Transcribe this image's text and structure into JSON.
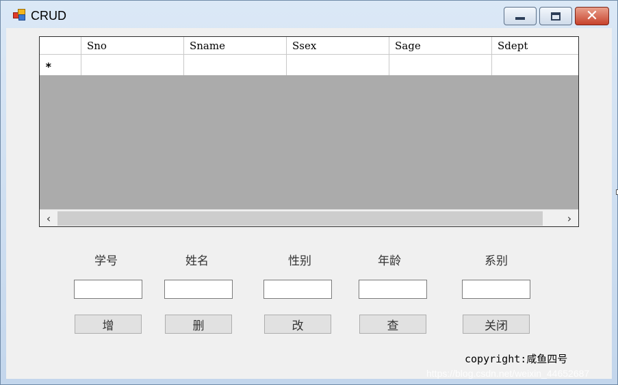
{
  "window": {
    "title": "CRUD",
    "controls": {
      "minimize": "minimize",
      "maximize": "maximize",
      "close": "✕"
    }
  },
  "grid": {
    "columns": [
      "Sno",
      "Sname",
      "Ssex",
      "Sage",
      "Sdept"
    ],
    "new_row_marker": "*",
    "rows": [
      [
        "",
        "",
        "",
        "",
        ""
      ]
    ],
    "scroll_left": "‹",
    "scroll_right": "›"
  },
  "form": {
    "fields": [
      {
        "label": "学号",
        "value": ""
      },
      {
        "label": "姓名",
        "value": ""
      },
      {
        "label": "性别",
        "value": ""
      },
      {
        "label": "年龄",
        "value": ""
      },
      {
        "label": "系别",
        "value": ""
      }
    ],
    "buttons": {
      "add": "增",
      "delete": "删",
      "update": "改",
      "query": "查",
      "close": "关闭"
    }
  },
  "footer": {
    "copyright": "copyright:咸鱼四号",
    "watermark": "https://blog.csdn.net/weixin_44652687"
  }
}
